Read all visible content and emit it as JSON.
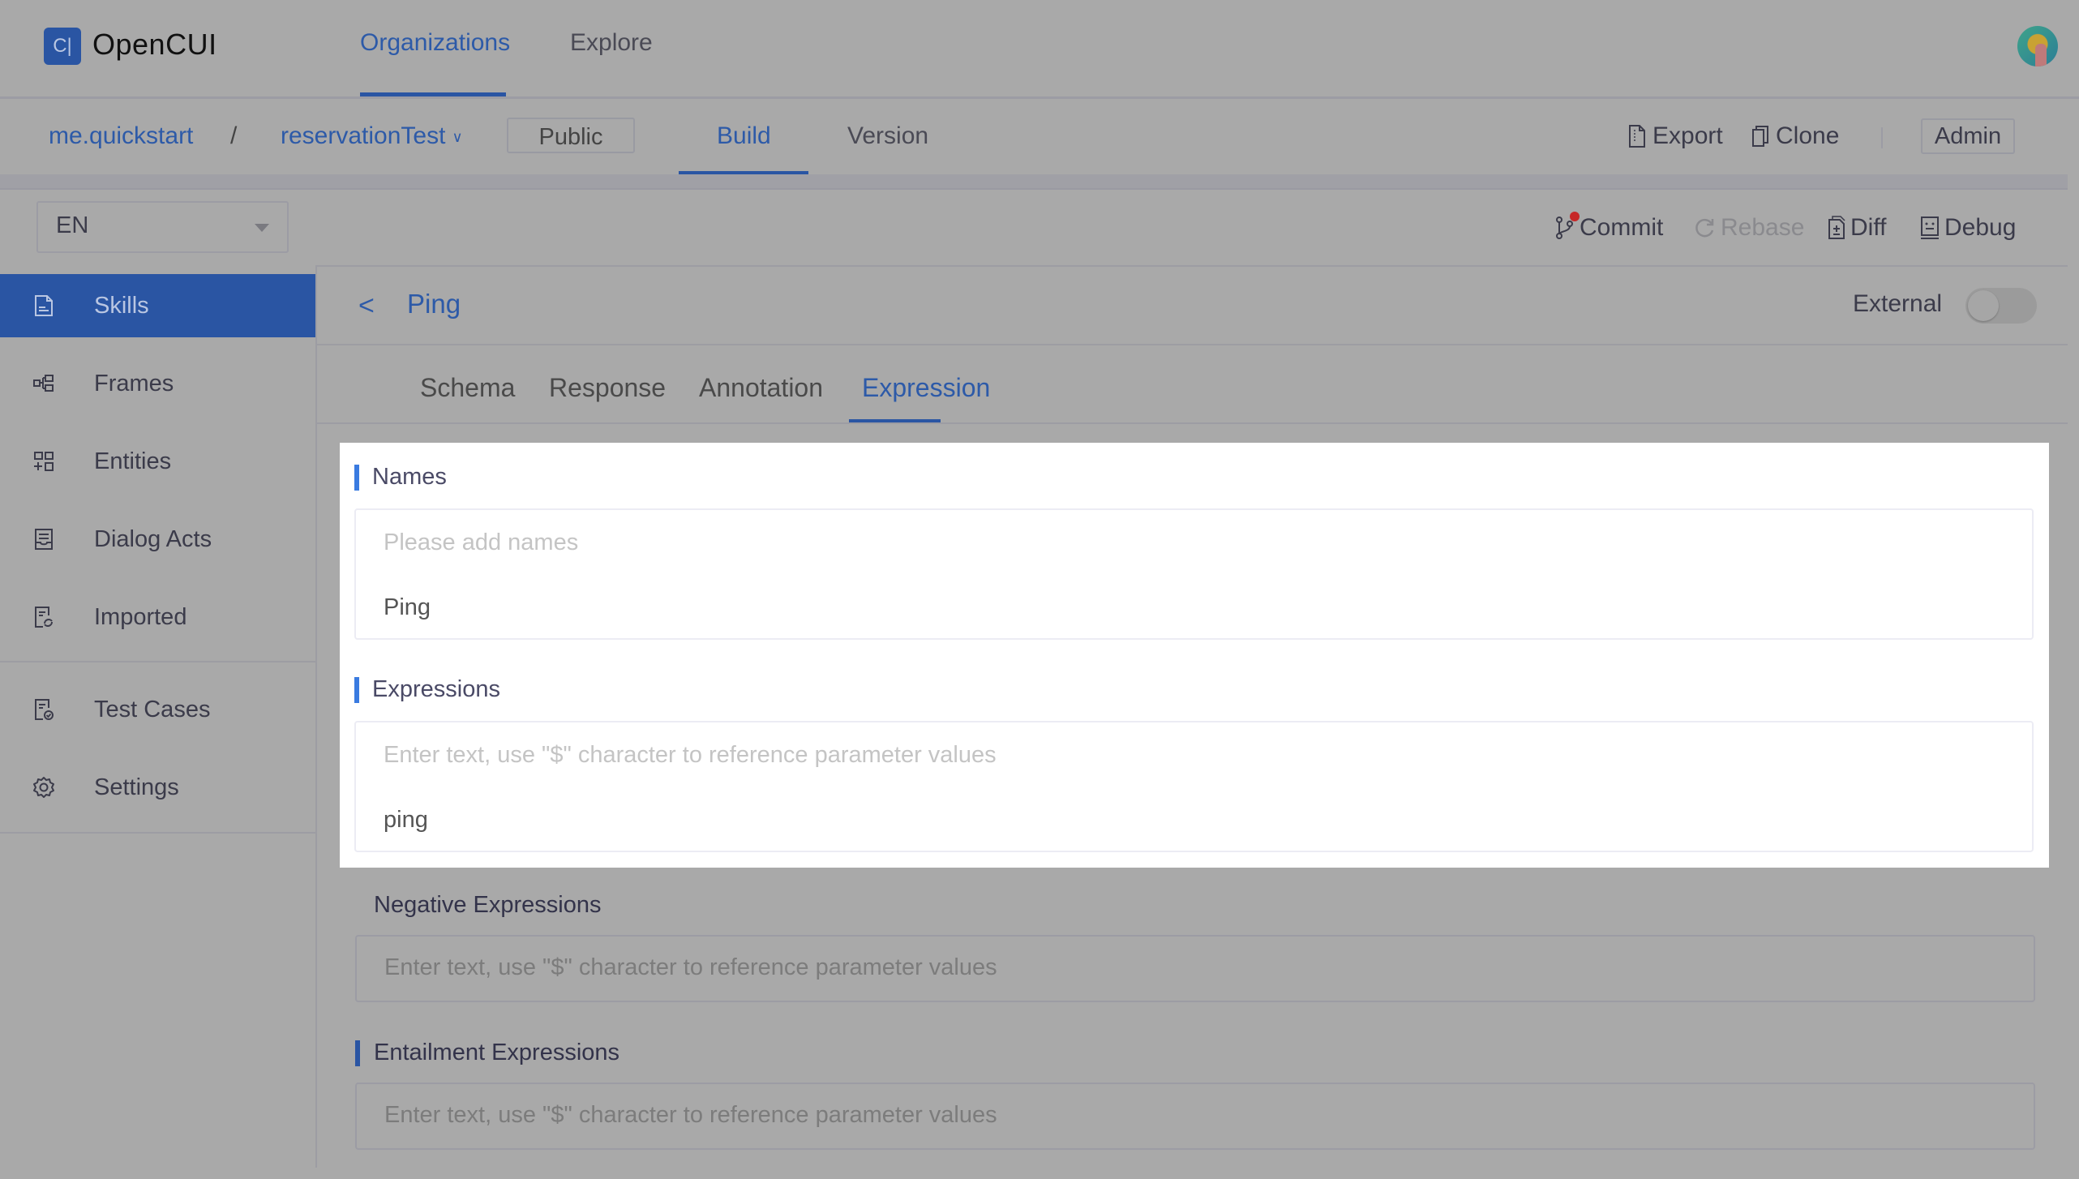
{
  "app": {
    "name": "OpenCUI",
    "logo_glyph": "C|"
  },
  "top_nav": {
    "items": [
      {
        "label": "Organizations",
        "active": true
      },
      {
        "label": "Explore",
        "active": false
      }
    ]
  },
  "breadcrumb": {
    "org": "me.quickstart",
    "separator": "/",
    "project": "reservationTest",
    "project_chevron": "∨",
    "visibility": "Public"
  },
  "project_tabs": [
    {
      "label": "Build",
      "active": true
    },
    {
      "label": "Version",
      "active": false
    }
  ],
  "header_actions": {
    "export": "Export",
    "clone": "Clone",
    "admin": "Admin"
  },
  "toolbar": {
    "language": "EN",
    "commit": "Commit",
    "rebase": "Rebase",
    "diff": "Diff",
    "debug": "Debug",
    "commit_has_changes": true,
    "rebase_disabled": true
  },
  "sidebar": {
    "items": [
      {
        "label": "Skills",
        "icon": "document-icon",
        "active": true
      },
      {
        "label": "Frames",
        "icon": "frames-icon",
        "active": false
      },
      {
        "label": "Entities",
        "icon": "entities-icon",
        "active": false
      },
      {
        "label": "Dialog Acts",
        "icon": "dialog-acts-icon",
        "active": false
      },
      {
        "label": "Imported",
        "icon": "imported-icon",
        "active": false
      },
      {
        "label": "Test Cases",
        "icon": "test-cases-icon",
        "active": false
      },
      {
        "label": "Settings",
        "icon": "gear-icon",
        "active": false
      }
    ]
  },
  "skill": {
    "title": "Ping",
    "back": "<",
    "external_label": "External",
    "external_enabled": false
  },
  "skill_tabs": [
    {
      "label": "Schema",
      "active": false
    },
    {
      "label": "Response",
      "active": false
    },
    {
      "label": "Annotation",
      "active": false
    },
    {
      "label": "Expression",
      "active": true
    }
  ],
  "sections": {
    "names": {
      "label": "Names",
      "placeholder": "Please add names",
      "values": [
        "Ping"
      ]
    },
    "expressions": {
      "label": "Expressions",
      "placeholder": "Enter text, use \"$\" character to reference parameter values",
      "values": [
        "ping"
      ]
    },
    "negative_expressions": {
      "label": "Negative Expressions",
      "placeholder": "Enter text, use \"$\" character to reference parameter values"
    },
    "entailment_expressions": {
      "label": "Entailment Expressions",
      "placeholder": "Enter text, use \"$\" character to reference parameter values"
    }
  },
  "colors": {
    "accent": "#2a55a3",
    "section_bar": "#3a7be0",
    "overlay_background": "#a9a9a9",
    "highlight_panel": "#ffffff",
    "notification_dot": "#c62828"
  }
}
